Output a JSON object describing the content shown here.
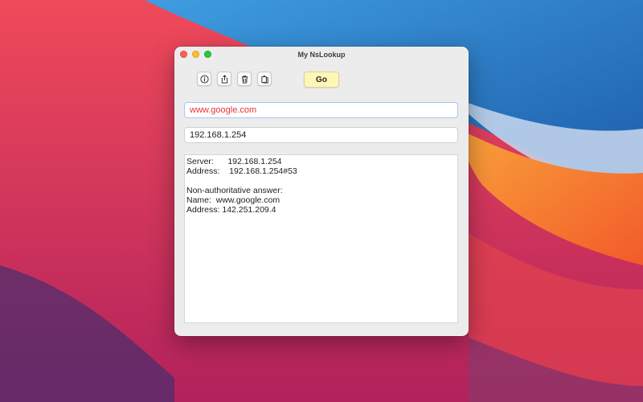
{
  "window": {
    "title": "My NsLookup"
  },
  "toolbar": {
    "info_icon": "info-icon",
    "share_icon": "share-icon",
    "trash_icon": "trash-icon",
    "copy_icon": "copy-icon",
    "go_label": "Go"
  },
  "inputs": {
    "hostname": "www.google.com",
    "dns_server": "192.168.1.254"
  },
  "output": {
    "lines": [
      "Server:      192.168.1.254",
      "Address:    192.168.1.254#53",
      "",
      "Non-authoritative answer:",
      "Name:  www.google.com",
      "Address: 142.251.209.4"
    ]
  },
  "colors": {
    "hostname_text": "#e8333a",
    "go_button": "#fdf6b7",
    "focus_ring": "#a7c6ee"
  }
}
